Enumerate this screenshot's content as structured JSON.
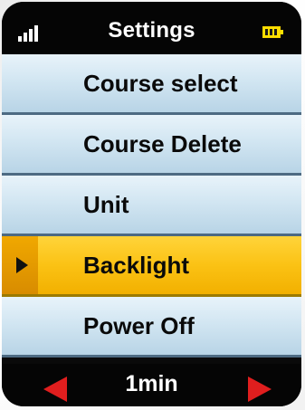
{
  "header": {
    "title": "Settings",
    "signal_icon": "signal-bars-icon",
    "battery_icon": "battery-icon",
    "battery_color": "#ffe000"
  },
  "menu": {
    "items": [
      {
        "label": "Course select",
        "selected": false
      },
      {
        "label": "Course Delete",
        "selected": false
      },
      {
        "label": "Unit",
        "selected": false
      },
      {
        "label": "Backlight",
        "selected": true
      },
      {
        "label": "Power Off",
        "selected": false
      }
    ],
    "selection_indicator_icon": "play-triangle-icon",
    "selected_color": "#fbc214",
    "item_color": "#d2e6f2"
  },
  "footer": {
    "value": "1min",
    "left_icon": "arrow-left-icon",
    "right_icon": "arrow-right-icon",
    "arrow_color": "#e01e1e"
  }
}
